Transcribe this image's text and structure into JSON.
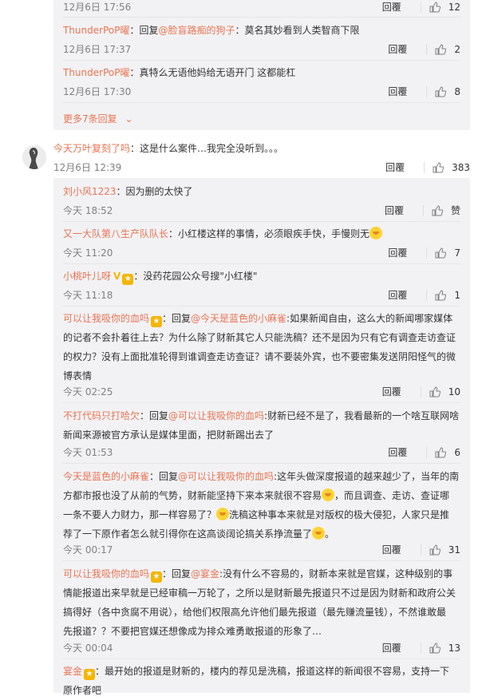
{
  "ui": {
    "reply_label": "回覆"
  },
  "top_partial": {
    "time": "12月6日 17:56",
    "likes": "12"
  },
  "sub_a": [
    {
      "nick": "ThunderPoP曜",
      "prefix": "：回复",
      "at": "@脸盲路痴的狗子",
      "text": "：莫名其妙看到人类智商下限",
      "time": "12月6日 17:37",
      "likes": "2"
    },
    {
      "nick": "ThunderPoP曜",
      "prefix": "：",
      "at": "",
      "text": "真特么无语他妈给无语开门 这都能杠",
      "time": "12月6日 17:30",
      "likes": "8"
    }
  ],
  "more_replies": "更多7条回复",
  "main_comment": {
    "nick": "今天万叶复刻了吗",
    "text": "：这是什么案件…我完全没听到。。。",
    "time": "12月6日 12:39",
    "likes": "383"
  },
  "sub_b": [
    {
      "nick": "刘小风1223",
      "text": "：因为删的太快了",
      "time": "今天 18:52",
      "likes": "赞"
    },
    {
      "nick": "又一大队第八生产队队长",
      "text": "：小红楼这样的事情，必须眼疾手快，手慢则无",
      "time": "今天 11:20",
      "likes": "7"
    },
    {
      "nick": "小桃叶儿呀",
      "text": "：没药花园公众号搜\"小红楼\"",
      "time": "今天 11:18",
      "likes": "1"
    },
    {
      "nick": "可以让我吸你的血吗",
      "prefix": "：回复",
      "at": "@今天是蓝色的小麻雀",
      "text1": ":如果新闻自由，这么大的新闻哪家媒体",
      "text2": "的记者不会扑着往上去？为什么除了财新其它人只能洗稿？还不是因为只有它有调查走访查证",
      "text3": "的权力？没有上面批准轮得到谁调查走访查证？请不要装外宾，也不要密集发送阴阳怪气的微",
      "text4": "博表情",
      "time": "今天 02:25",
      "likes": "10"
    },
    {
      "nick": "不打代码只打哈欠",
      "prefix": "：回复",
      "at": "@可以让我吸你的血吗",
      "text1": ":财新已经不是了，我看最新的一个啥互联网啥",
      "text2": "新闻来源被官方承认是媒体里面，把财新踢出去了",
      "time": "今天 01:53",
      "likes": "6"
    },
    {
      "nick": "今天是蓝色的小麻雀",
      "prefix": "：回复",
      "at": "@可以让我吸你的血吗",
      "text1": ":这年头做深度报道的越来越少了，当年的南",
      "text2": "方都市报也没了从前的气势，财新能坚持下来本来就很不容易",
      "text2b": "，而且调查、走访、查证哪",
      "text3": "一条不要人力财力，那一样容易了？",
      "text3b": "洗稿这种事本来就是对版权的极大侵犯，人家只是推",
      "text4": "荐了一下原作者怎么就引得你在这高谈阔论搞关系挣流量了",
      "text4b": "。",
      "time": "今天 00:17",
      "likes": "31"
    },
    {
      "nick": "可以让我吸你的血吗",
      "prefix": "：回复",
      "at": "@宴金",
      "text1": ":没有什么不容易的，财新本来就是官媒，这种级别的事",
      "text2": "情能报道出来早就是已经审稿一万轮了，之所以是财新最先报道只不过是因为财新和政府公关",
      "text3": "搞得好（各中贪腐不用说），给他们权限高允许他们最先报道（最先赚流量钱），不然谁敢最",
      "text4": "先报道？？不要把官媒还想像成为排众难勇敢报道的形象了…",
      "time": "今天 00:04",
      "likes": "13"
    },
    {
      "nick": "宴金",
      "text1": "：最开始的报道是财新的，楼内的荐见是洗稿，报道这样的新闻很不容易，支持一下",
      "text2": "原作者吧"
    }
  ]
}
